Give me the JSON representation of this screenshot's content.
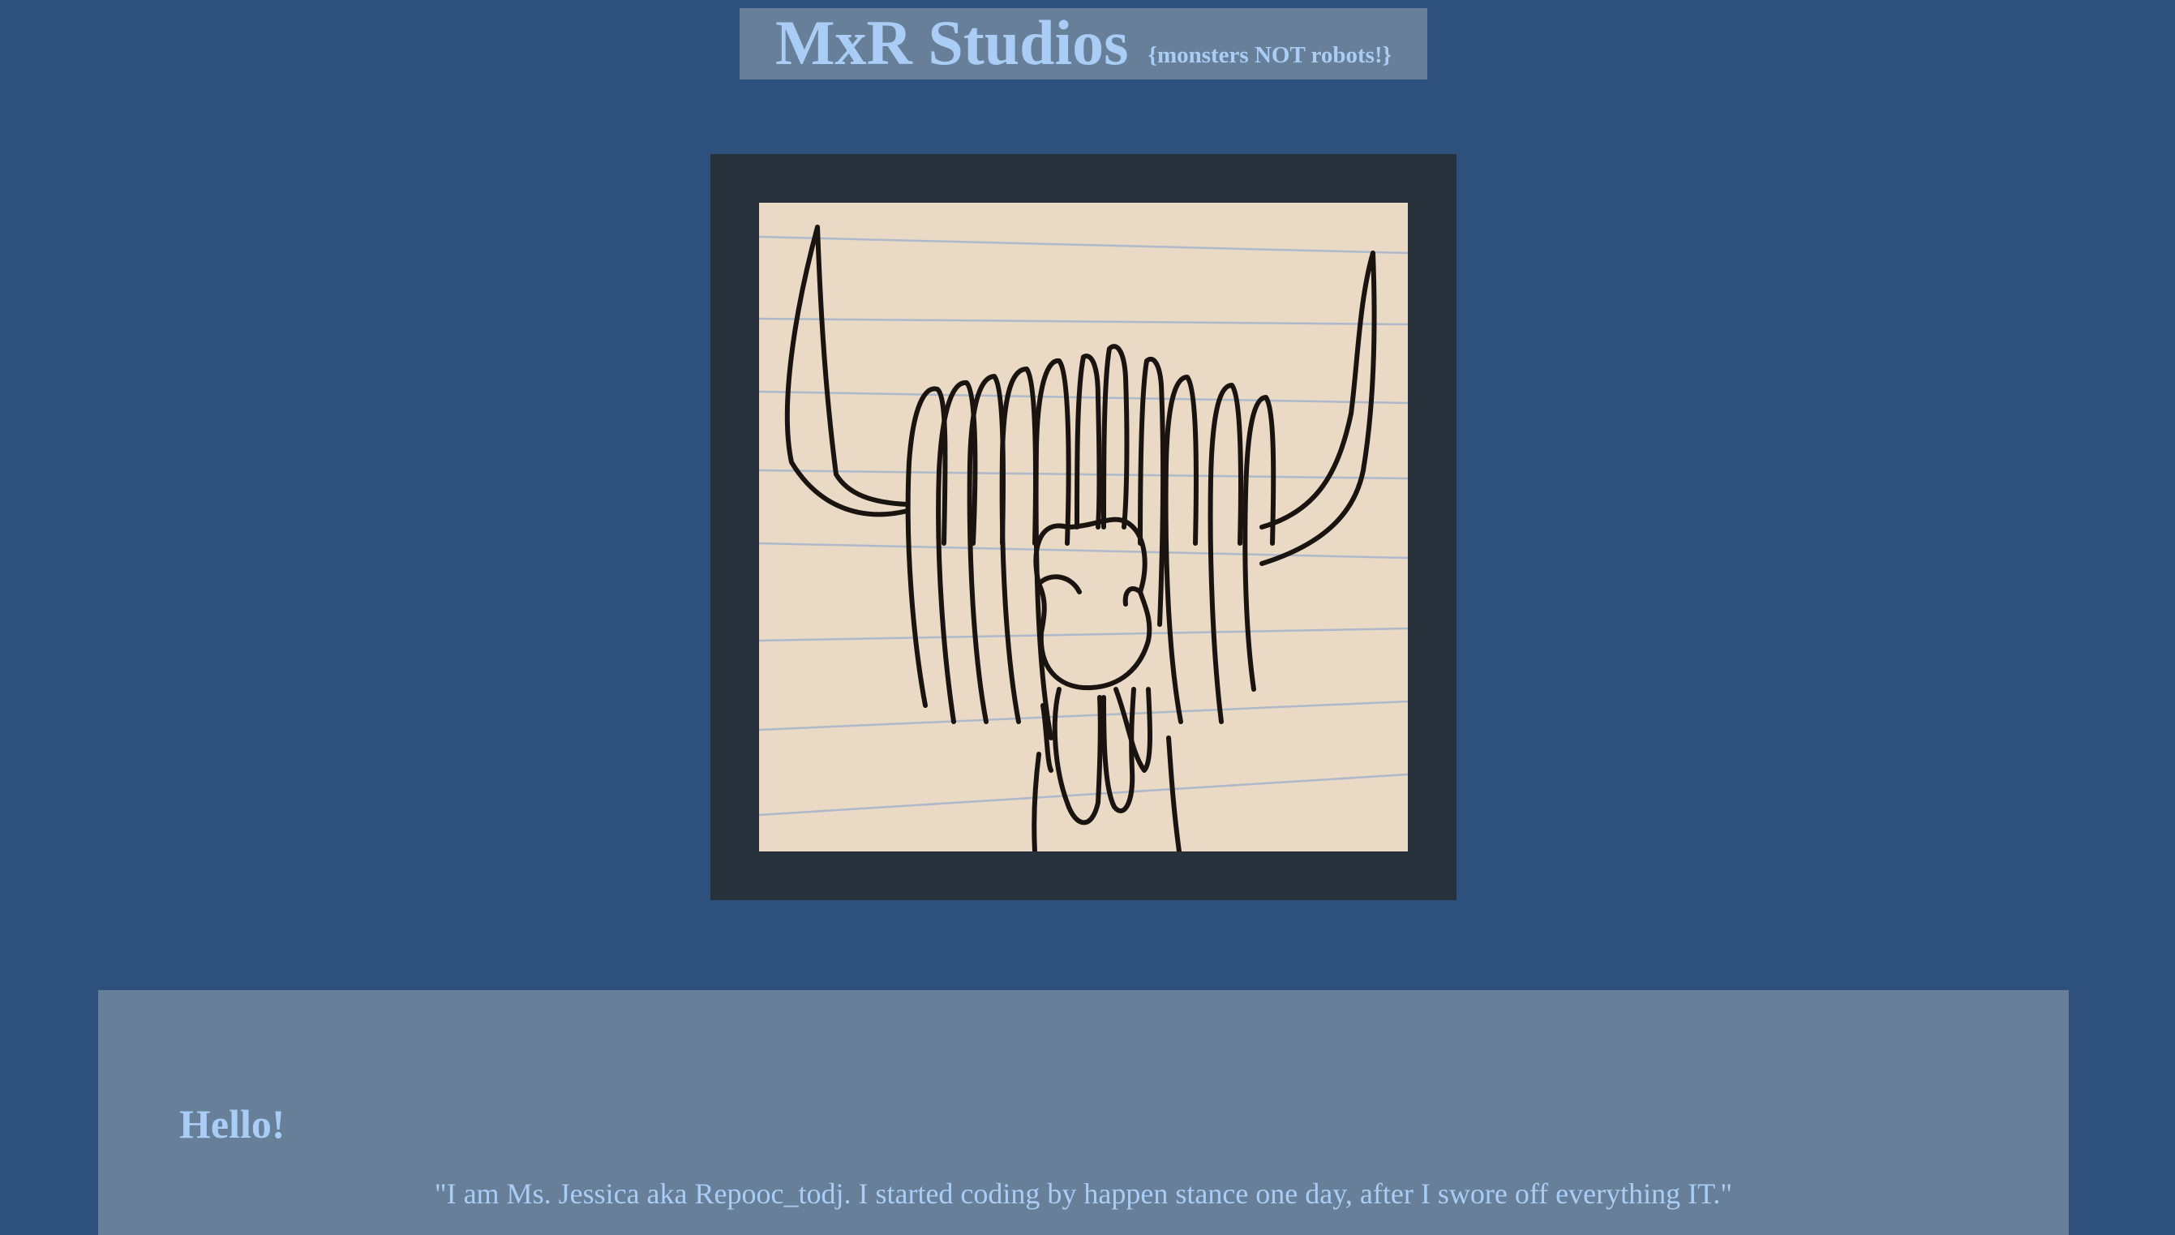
{
  "header": {
    "title": "MxR Studios",
    "tagline": "{monsters NOT robots!}"
  },
  "hero": {
    "image_icon": "yak-drawing-icon"
  },
  "about": {
    "heading": "Hello!",
    "quote": "\"I am Ms. Jessica aka Repooc_todj. I started coding by happen stance one day, after I swore off everything IT.\""
  },
  "colors": {
    "page_background": "#2e507c",
    "panel_background": "#677f99",
    "frame_background": "#27313b",
    "text": "#a9cdf5",
    "paper": "#ead9c5"
  }
}
